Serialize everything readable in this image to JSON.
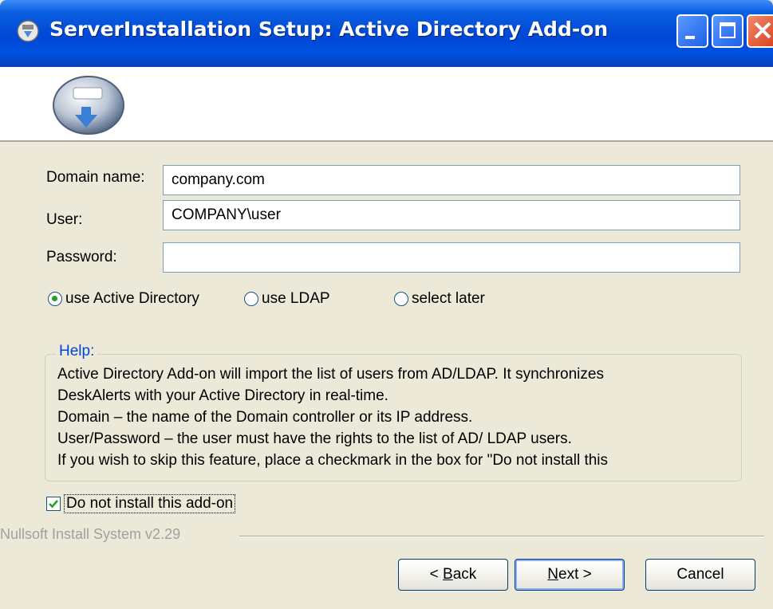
{
  "window": {
    "title": "ServerInstallation Setup: Active Directory Add-on"
  },
  "form": {
    "domain_label": "Domain name:",
    "domain_value": "company.com",
    "user_label": "User:",
    "user_value": "COMPANY\\user",
    "password_label": "Password:",
    "password_value": ""
  },
  "radios": [
    {
      "label": "use Active Directory",
      "selected": true
    },
    {
      "label": "use LDAP",
      "selected": false
    },
    {
      "label": "select later",
      "selected": false
    }
  ],
  "help": {
    "legend": "Help:",
    "lines": [
      "Active Directory Add-on will import the list of users from AD/LDAP. It synchronizes",
      "DeskAlerts with your Active Directory in real-time.",
      "Domain – the name of the Domain controller or its IP address.",
      "User/Password – the user must have the rights to the list of AD/ LDAP users.",
      "If you wish to skip this feature, place a checkmark in the box for \"Do not install this"
    ]
  },
  "checkbox": {
    "label": "Do not install this add-on",
    "checked": true
  },
  "footer": {
    "branding": "Nullsoft Install System v2.29"
  },
  "buttons": {
    "back": {
      "prefix": "< ",
      "accel": "B",
      "rest": "ack"
    },
    "next": {
      "accel": "N",
      "rest": "ext >"
    },
    "cancel": "Cancel"
  },
  "colors": {
    "titlebar": "#0047d6",
    "dialog_bg": "#ece9d8",
    "help_legend": "#0046d5",
    "radio_dot": "#21a121"
  }
}
